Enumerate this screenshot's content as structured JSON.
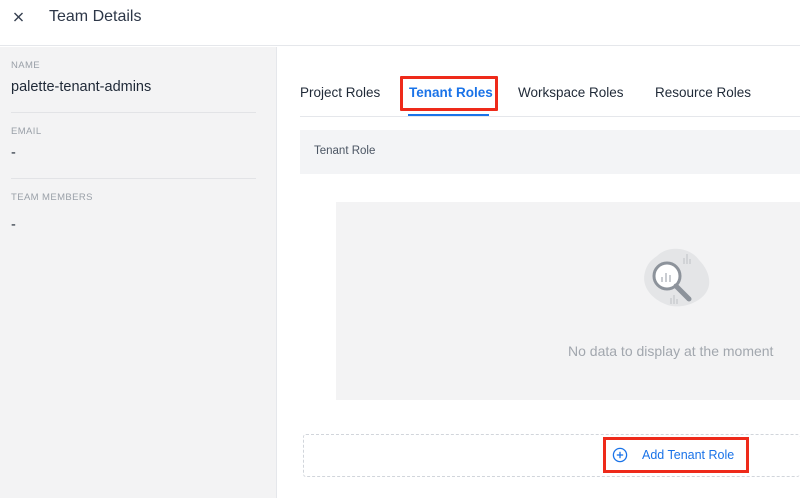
{
  "header": {
    "title": "Team Details",
    "close_icon": "close-icon"
  },
  "sidebar": {
    "name_label": "NAME",
    "name_value": "palette-tenant-admins",
    "email_label": "EMAIL",
    "email_value": "-",
    "members_label": "TEAM MEMBERS",
    "members_value": "-"
  },
  "tabs": [
    {
      "label": "Project Roles",
      "active": false
    },
    {
      "label": "Tenant Roles",
      "active": true
    },
    {
      "label": "Workspace Roles",
      "active": false
    },
    {
      "label": "Resource Roles",
      "active": false
    }
  ],
  "table": {
    "column_header": "Tenant Role",
    "empty_text": "No data to display at the moment",
    "empty_icon": "magnifier-icon"
  },
  "actions": {
    "add_label": "Add Tenant Role",
    "add_icon": "plus-circle-icon"
  },
  "colors": {
    "accent": "#1a73e8",
    "highlight": "#ee2a1a",
    "sidebar_bg": "#f3f3f4"
  }
}
